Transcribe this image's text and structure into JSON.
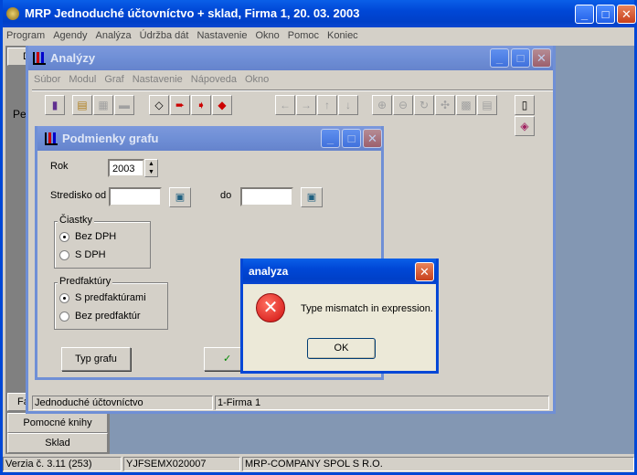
{
  "main_window": {
    "title": "MRP Jednoduché účtovníctvo + sklad,  Firma 1,  20. 03. 2003",
    "menu": [
      "Program",
      "Agendy",
      "Analýza",
      "Údržba dát",
      "Nastavenie",
      "Okno",
      "Pomoc",
      "Koniec"
    ],
    "sidebar_frags": {
      "top": "D",
      "pe": "Pe",
      "fa": "Fa"
    },
    "sidebar_buttons": [
      "Pomocné knihy",
      "Sklad"
    ],
    "status": [
      "Verzia č. 3.11 (253)",
      "YJFSEMX020007",
      "MRP-COMPANY SPOL S R.O."
    ]
  },
  "analyzy": {
    "title": "Analýzy",
    "menu": [
      "Súbor",
      "Modul",
      "Graf",
      "Nastavenie",
      "Nápoveda",
      "Okno"
    ],
    "status": [
      "Jednoduché účtovníctvo",
      "1-Firma 1"
    ]
  },
  "dialog": {
    "title": "Podmienky grafu",
    "rok_label": "Rok",
    "rok_value": "2003",
    "stredisko_label": "Stredisko od",
    "do_label": "do",
    "ciastky_label": "Čiastky",
    "ciastky_options": [
      "Bez DPH",
      "S DPH"
    ],
    "ciastky_selected": 0,
    "predfaktury_label": "Predfaktúry",
    "predfaktury_options": [
      "S predfaktúrami",
      "Bez predfaktúr"
    ],
    "predfaktury_selected": 0,
    "typ_grafu_label": "Typ grafu",
    "ok_frag": "✓  "
  },
  "msgbox": {
    "title": "analyza",
    "message": "Type mismatch in expression.",
    "ok_label": "OK"
  },
  "icons": {
    "app": "mrp-coin-icon",
    "chart": "bar-chart-icon",
    "error": "error-x-icon"
  }
}
